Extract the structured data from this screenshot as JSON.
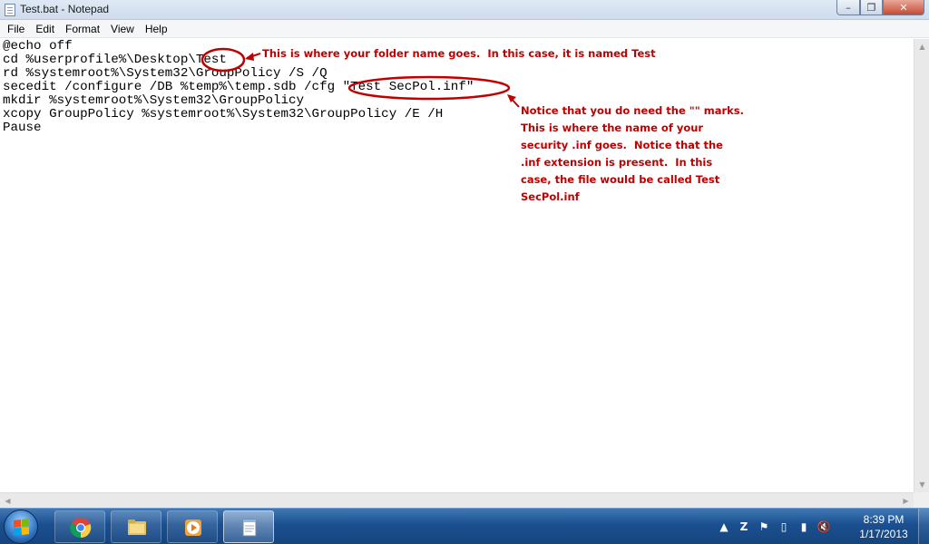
{
  "window": {
    "title": "Test.bat - Notepad",
    "minimize_icon": "minimize-icon",
    "maximize_icon": "maximize-icon",
    "close_icon": "close-icon"
  },
  "menu": [
    "File",
    "Edit",
    "Format",
    "View",
    "Help"
  ],
  "code": [
    "@echo off",
    "cd %userprofile%\\Desktop\\Test",
    "rd %systemroot%\\System32\\GroupPolicy /S /Q",
    "secedit /configure /DB %temp%\\temp.sdb /cfg \"Test SecPol.inf\"",
    "mkdir %systemroot%\\System32\\GroupPolicy",
    "xcopy GroupPolicy %systemroot%\\System32\\GroupPolicy /E /H",
    "Pause"
  ],
  "annotations": {
    "folder_note": "This is where your folder name goes.  In this case, it is named Test",
    "inf_note": [
      "Notice that you do need the \"\" marks.",
      "This is where the name of your",
      "security .inf goes.  Notice that the",
      ".inf extension is present.  In this",
      "case, the file would be called Test",
      "SecPol.inf"
    ],
    "color": "#c00000"
  },
  "taskbar": {
    "apps": [
      "chrome-icon",
      "explorer-folder-icon",
      "media-player-icon",
      "notepad-icon"
    ],
    "tray_icons": [
      "show-hidden-icons-arrow",
      "zonealarm-icon",
      "action-center-flag-icon",
      "battery-icon",
      "network-signal-icon",
      "volume-muted-icon"
    ],
    "time": "8:39 PM",
    "date": "1/17/2013"
  }
}
